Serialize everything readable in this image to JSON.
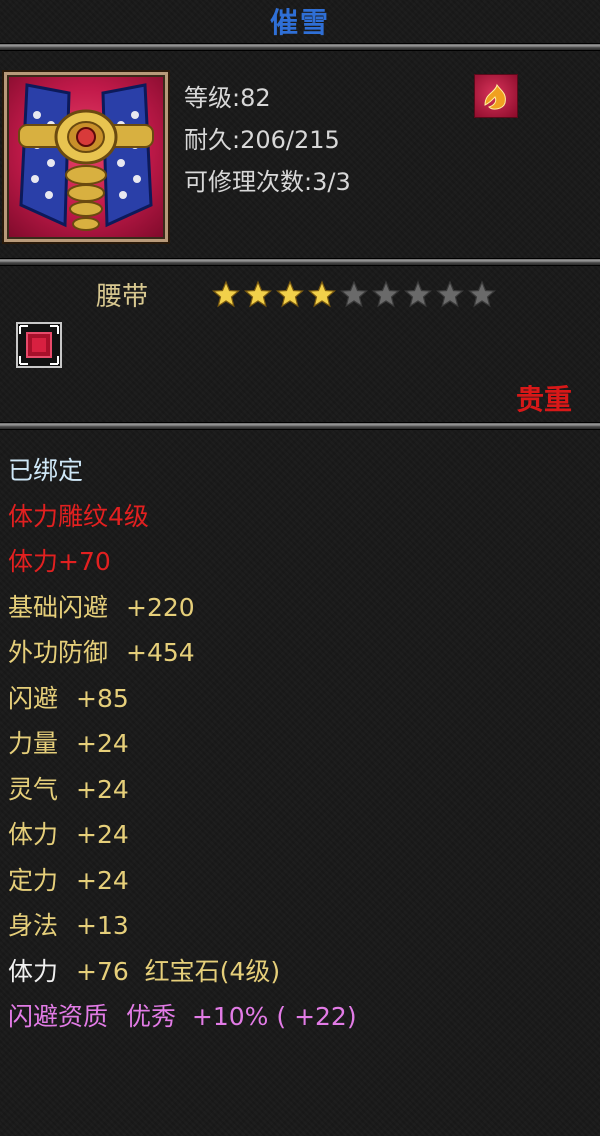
{
  "title": "催雪",
  "header": {
    "level_line": "等级:82",
    "durability_line": "耐久:206/215",
    "repair_line": "可修理次数:3/3"
  },
  "item_type": "腰带",
  "stars": {
    "filled": 4,
    "total": 9
  },
  "rarity": "贵重",
  "stats": [
    {
      "label": "已绑定",
      "value": "",
      "color": "#cfe8f8"
    },
    {
      "label": "体力雕纹4级",
      "value": "",
      "color": "#e22020"
    },
    {
      "label": "体力+70",
      "value": "",
      "color": "#e22020"
    },
    {
      "label": "基础闪避",
      "value": "+220",
      "color": "#e6cf7a"
    },
    {
      "label": "外功防御",
      "value": "+454",
      "color": "#e6cf7a"
    },
    {
      "label": "闪避",
      "value": "+85",
      "color": "#e6cf7a"
    },
    {
      "label": "力量",
      "value": "+24",
      "color": "#e6cf7a"
    },
    {
      "label": "灵气",
      "value": "+24",
      "color": "#e6cf7a"
    },
    {
      "label": "体力",
      "value": "+24",
      "color": "#e6cf7a"
    },
    {
      "label": "定力",
      "value": "+24",
      "color": "#e6cf7a"
    },
    {
      "label": "身法",
      "value": "+13",
      "color": "#e6cf7a"
    },
    {
      "label": "体力",
      "value": "+76  红宝石(4级)",
      "color": "#f0f0f0",
      "value_color": "#e6cf7a"
    },
    {
      "label": "闪避资质",
      "value": "优秀  +10% ( +22)",
      "color": "#e27be6"
    }
  ],
  "icons": {
    "item_icon": "belt-armor-icon",
    "badge": "flame-emblem-icon",
    "gem_socket": "gem-socket-icon"
  }
}
